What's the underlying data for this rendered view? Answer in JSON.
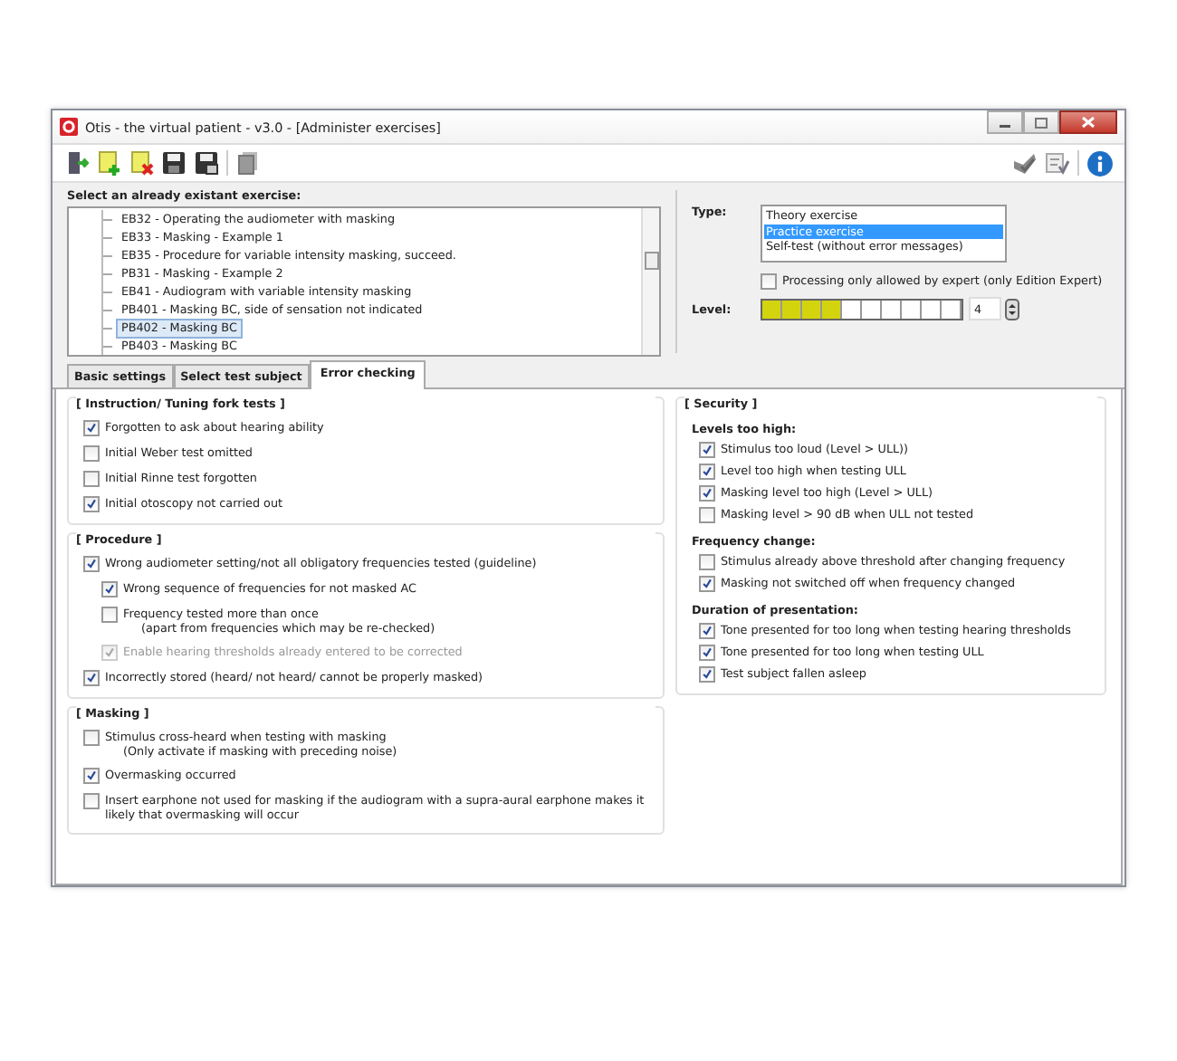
{
  "window": {
    "title": "Otis - the virtual patient - v3.0 - [Administer exercises]"
  },
  "exercise_list": {
    "label": "Select an already existant exercise:",
    "items": [
      {
        "text": "EB32 - Operating the audiometer with masking",
        "selected": false
      },
      {
        "text": "EB33 - Masking - Example 1",
        "selected": false
      },
      {
        "text": "EB35 - Procedure for variable intensity masking, succeed.",
        "selected": false
      },
      {
        "text": "PB31 - Masking - Example 2",
        "selected": false
      },
      {
        "text": "EB41 - Audiogram with variable intensity masking",
        "selected": false
      },
      {
        "text": "PB401 - Masking BC, side of sensation not indicated",
        "selected": false
      },
      {
        "text": "PB402 - Masking BC",
        "selected": true
      },
      {
        "text": "PB403 - Masking BC",
        "selected": false
      }
    ]
  },
  "type": {
    "label": "Type:",
    "options": [
      {
        "text": "Theory exercise",
        "selected": false
      },
      {
        "text": "Practice exercise",
        "selected": true
      },
      {
        "text": "Self-test (without  error messages)",
        "selected": false
      }
    ]
  },
  "expert_only": {
    "label": "Processing only allowed by expert (only Edition Expert)",
    "checked": false
  },
  "level": {
    "label": "Level:",
    "level": 0.4,
    "value": "4"
  },
  "tabs": [
    {
      "label": "Basic settings",
      "selected": false
    },
    {
      "label": "Select test subject",
      "selected": false
    },
    {
      "label": "Error checking",
      "selected": true
    }
  ],
  "left_sections": [
    {
      "title": "[ Instruction/ Tuning fork tests ]",
      "items": [
        {
          "label": "Forgotten to ask about hearing ability",
          "checked": true,
          "disabled": false
        },
        {
          "label": "Initial Weber test omitted",
          "checked": false,
          "disabled": false
        },
        {
          "label": "Initial Rinne test forgotten",
          "checked": false,
          "disabled": false
        },
        {
          "label": "Initial otoscopy not carried out",
          "checked": true,
          "disabled": false
        }
      ]
    },
    {
      "title": "[ Procedure ]",
      "items": [
        {
          "label": "Wrong audiometer setting/not all obligatory frequencies tested (guideline)",
          "checked": true,
          "disabled": false,
          "children": [
            {
              "label": "Wrong sequence of frequencies for not masked AC",
              "checked": true,
              "disabled": false
            },
            {
              "label": "Frequency tested more than once",
              "note": "(apart from frequencies which may be re-checked)",
              "checked": false,
              "disabled": false
            },
            {
              "label": "Enable hearing thresholds already entered to be corrected",
              "checked": true,
              "disabled": true
            }
          ]
        },
        {
          "label": "Incorrectly stored (heard/ not heard/ cannot be properly masked)",
          "checked": true,
          "disabled": false
        }
      ]
    },
    {
      "title": "[ Masking ]",
      "items": [
        {
          "label": "Stimulus cross-heard when testing with masking",
          "note": "(Only activate if masking with preceding noise)",
          "checked": false,
          "disabled": false
        },
        {
          "label": "Overmasking occurred",
          "checked": true,
          "disabled": false
        },
        {
          "label": "Insert earphone not used for masking if the audiogram with a supra-aural earphone makes it likely that overmasking will occur",
          "checked": false,
          "disabled": false
        }
      ]
    }
  ],
  "security": {
    "title": "[ Security ]",
    "groups": [
      {
        "title": "Levels too high:",
        "items": [
          {
            "label": "Stimulus too loud (Level > ULL))",
            "checked": true
          },
          {
            "label": "Level too high when testing ULL",
            "checked": true
          },
          {
            "label": "Masking level too high (Level > ULL)",
            "checked": true
          },
          {
            "label": "Masking level > 90 dB when ULL not tested",
            "checked": false
          }
        ]
      },
      {
        "title": "Frequency change:",
        "items": [
          {
            "label": "Stimulus already above threshold after changing frequency",
            "checked": false
          },
          {
            "label": "Masking not switched off when frequency changed",
            "checked": true
          }
        ]
      },
      {
        "title": "Duration of presentation:",
        "items": [
          {
            "label": "Tone presented for too long when testing hearing thresholds",
            "checked": true
          },
          {
            "label": "Tone presented for too long when testing ULL",
            "checked": true
          },
          {
            "label": "Test subject fallen asleep",
            "checked": true
          }
        ]
      }
    ]
  }
}
